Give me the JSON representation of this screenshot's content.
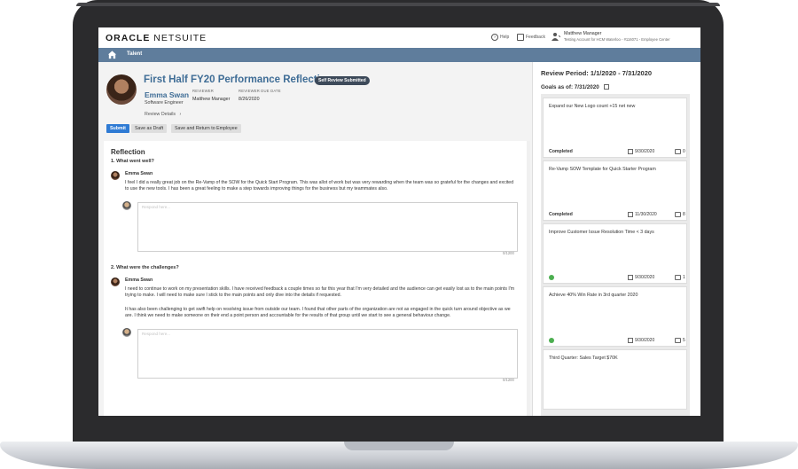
{
  "app": {
    "logo_bold": "ORACLE",
    "logo_thin": "NETSUITE",
    "help_label": "Help",
    "feedback_label": "Feedback",
    "user_name": "Matthew Manager",
    "user_account": "Testing Account for HCM Waterloo - #116071 - Employee Center"
  },
  "nav": {
    "label": "Talent"
  },
  "review": {
    "title": "First Half FY20 Performance Reflection",
    "badge": "Self Review Submitted",
    "employee_name": "Emma Swan",
    "employee_role": "Software Engineer",
    "reviewer_header": "REVIEWER",
    "reviewer_value": "Matthew Manager",
    "due_header": "REVIEWER DUE DATE",
    "due_value": "8/26/2020",
    "details_label": "Review Details",
    "buttons": {
      "submit": "Submit",
      "draft": "Save as Draft",
      "return": "Save and Return to Employee"
    }
  },
  "reflection": {
    "heading": "Reflection",
    "questions": [
      {
        "label": "1. What went well?",
        "author": "Emma Swan",
        "paragraphs": [
          "I feel I did a really great job on the Re-Vamp of the SOW for the Quick Start Program.  This was allot of work but was very rewarding when the team was so grateful for the changes and excited to use the new tools.  I has been a great feeling to make a step towards improving things for the business but my teammates also."
        ],
        "placeholder": "Respond here...",
        "counter": "0/1200"
      },
      {
        "label": "2. What were the challenges?",
        "author": "Emma Swan",
        "paragraphs": [
          "I need to continue to work on my presentation skills.  I have received feedback a couple times so far this year that I'm very detailed and the audience can get easily lost as to the main points I'm trying to make.  I will need to make sure I stick to the main points and only dive into the details if requested.",
          "It has also been challenging to get swift help on resolving issue from outside our team.  I found that other parts of the organization are not as engaged in the quick turn around objective as we are.  I think we need to make someone on their end a point person and accountable for the results of that group until we start to see a general behaviour change."
        ],
        "placeholder": "Respond here...",
        "counter": "0/1200"
      }
    ]
  },
  "goals_panel": {
    "period": "Review Period: 1/1/2020 - 7/31/2020",
    "goals_as_of": "Goals as of: 7/31/2020",
    "goals": [
      {
        "name": "Expand our New Logo count +15 net new",
        "status": "Completed",
        "date": "9/30/2020",
        "comments": "0",
        "on_track": false
      },
      {
        "name": "Re-Vamp SOW Template for Quick Starter Program",
        "status": "Completed",
        "date": "11/30/2020",
        "comments": "8",
        "on_track": false
      },
      {
        "name": "Improve Customer Issue Resolution Time < 3 days",
        "status": "",
        "date": "9/30/2020",
        "comments": "1",
        "on_track": true
      },
      {
        "name": "Achieve 40% Win Rate in 3rd quarter 2020",
        "status": "",
        "date": "9/30/2020",
        "comments": "5",
        "on_track": true
      },
      {
        "name": "Third Quarter: Sales Target $70K",
        "status": "",
        "date": "",
        "comments": "",
        "on_track": false
      }
    ]
  },
  "colors": {
    "accent": "#2f7bd4",
    "nav": "#5f7d9c",
    "title": "#3f6d96",
    "success": "#4caf50"
  }
}
